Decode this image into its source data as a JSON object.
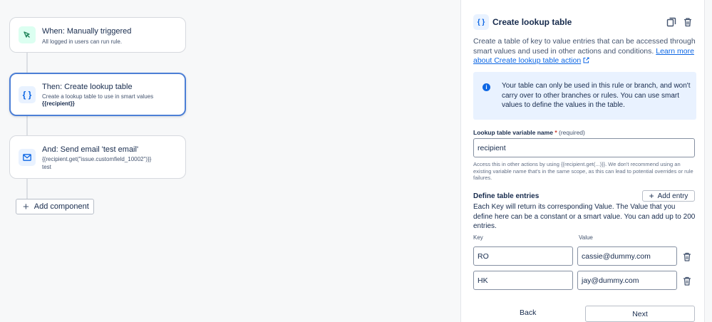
{
  "flow": {
    "trigger": {
      "icon": "cursor-icon",
      "title": "When: Manually triggered",
      "desc": "All logged in users can run rule."
    },
    "action1": {
      "icon": "braces-icon",
      "title": "Then: Create lookup table",
      "desc": "Create a lookup table to use in smart values",
      "desc2": "{{recipient}}"
    },
    "action2": {
      "icon": "mail-icon",
      "title": "And: Send email 'test email'",
      "desc": "{{recipient.get(\"issue.customfield_10002\")}}",
      "desc2": "test"
    },
    "add_component": "Add component"
  },
  "panel": {
    "icon_text": "{ }",
    "title": "Create lookup table",
    "desc": "Create a table of key to value entries that can be accessed through smart values and used in other actions and conditions.",
    "link": "Learn more about Create lookup table action",
    "info": "Your table can only be used in this rule or branch, and won't carry over to other branches or rules. You can use smart values to define the values in the table.",
    "var_label": "Lookup table variable name",
    "var_required": "*",
    "var_required_text": "(required)",
    "var_value": "recipient",
    "var_help": "Access this in other actions by using {{recipient.get(...)}}. We don't recommend using an existing variable name that's in the same scope, as this can lead to potential overrides or rule failures.",
    "entries_title": "Define table entries",
    "add_entry": "Add entry",
    "entries_desc": "Each Key will return its corresponding Value. The Value that you define here can be a constant or a smart value. You can add up to 200 entries.",
    "col_key": "Key",
    "col_value": "Value",
    "rows": [
      {
        "key": "RO",
        "value": "cassie@dummy.com"
      },
      {
        "key": "HK",
        "value": "jay@dummy.com"
      }
    ],
    "back": "Back",
    "next": "Next"
  },
  "colors": {
    "accent": "#0c66e4",
    "selected_border": "#4c7fd6",
    "info_bg": "#e9f2ff"
  }
}
